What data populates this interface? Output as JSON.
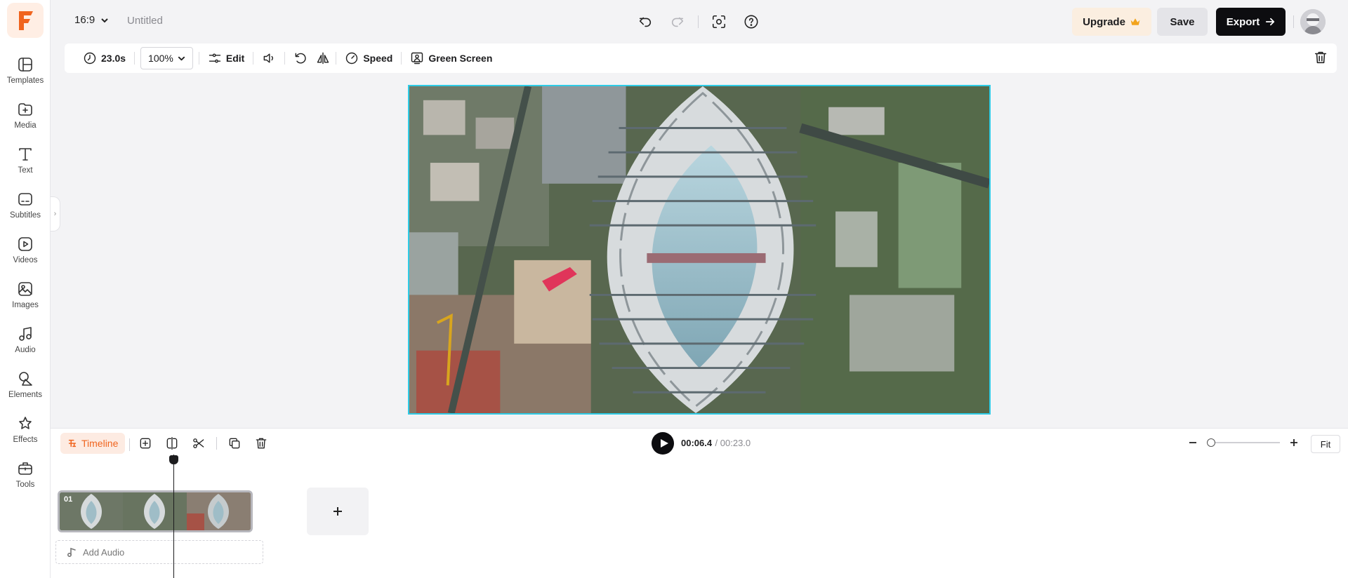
{
  "app": {
    "accent_color": "#f0641e",
    "selection_color": "#2ecbe6"
  },
  "sidebar": {
    "items": [
      {
        "label": "Templates",
        "icon": "templates-icon"
      },
      {
        "label": "Media",
        "icon": "media-icon"
      },
      {
        "label": "Text",
        "icon": "text-icon"
      },
      {
        "label": "Subtitles",
        "icon": "subtitles-icon"
      },
      {
        "label": "Videos",
        "icon": "videos-icon"
      },
      {
        "label": "Images",
        "icon": "images-icon"
      },
      {
        "label": "Audio",
        "icon": "audio-icon"
      },
      {
        "label": "Elements",
        "icon": "elements-icon"
      },
      {
        "label": "Effects",
        "icon": "effects-icon"
      },
      {
        "label": "Tools",
        "icon": "tools-icon"
      }
    ]
  },
  "header": {
    "aspect_ratio": "16:9",
    "title": "Untitled",
    "upgrade_label": "Upgrade",
    "save_label": "Save",
    "export_label": "Export"
  },
  "property_toolbar": {
    "duration": "23.0s",
    "zoom": "100%",
    "edit_label": "Edit",
    "speed_label": "Speed",
    "green_screen_label": "Green Screen"
  },
  "timeline": {
    "label": "Timeline",
    "current_time": "00:06.4",
    "total_time": "/ 00:23.0",
    "fit_label": "Fit",
    "zoom_level": 0.0,
    "clips": [
      {
        "number": "01"
      }
    ],
    "add_audio_label": "Add Audio"
  }
}
